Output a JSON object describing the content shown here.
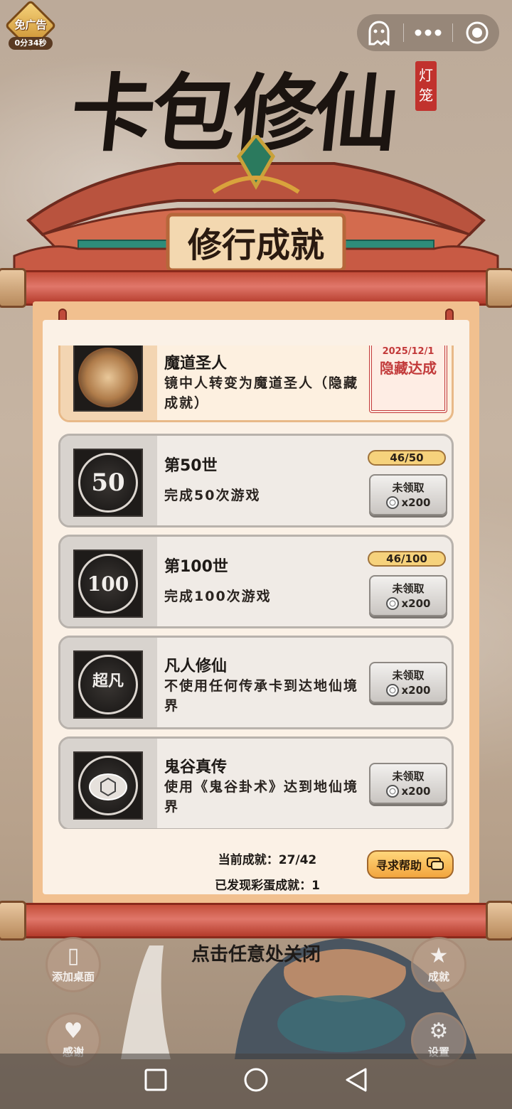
{
  "ad_badge": {
    "label": "免广告",
    "timer": "0分34秒"
  },
  "capsule": {
    "icons": [
      "ghost-icon",
      "more-icon",
      "record-icon"
    ]
  },
  "game": {
    "title": "卡包修仙",
    "seal": "灯笼"
  },
  "panel": {
    "title": "修行成就"
  },
  "achievements": [
    {
      "title": "魔道圣人",
      "desc": "镜中人转变为魔道圣人（隐藏成就）",
      "icon": "skull-emblem-icon",
      "status": "achieved",
      "stamp_date": "2025/12/1",
      "stamp_text": "隐藏达成"
    },
    {
      "title": "第50世",
      "desc": "完成50次游戏",
      "icon_text": "50",
      "progress": "46/50",
      "claim_label": "未领取",
      "reward": "x200"
    },
    {
      "title": "第100世",
      "desc": "完成100次游戏",
      "icon_text": "100",
      "progress": "46/100",
      "claim_label": "未领取",
      "reward": "x200"
    },
    {
      "title": "凡人修仙",
      "desc": "不使用任何传承卡到达地仙境界",
      "icon": "immortal-figure-icon",
      "icon_text": "超凡",
      "claim_label": "未领取",
      "reward": "x200"
    },
    {
      "title": "鬼谷真传",
      "desc": "使用《鬼谷卦术》达到地仙境界",
      "icon": "turtle-shell-icon",
      "claim_label": "未领取",
      "reward": "x200"
    }
  ],
  "stats": {
    "current": "当前成就：27/42",
    "easter": "已发现彩蛋成就：1"
  },
  "help_button": "寻求帮助",
  "close_hint": "点击任意处关闭",
  "side_buttons": {
    "add_desktop": "添加桌面",
    "thanks": "感谢",
    "achievements": "成就",
    "settings": "设置"
  },
  "navbar": {
    "icons": [
      "square-icon",
      "circle-home-icon",
      "triangle-back-icon"
    ]
  },
  "colors": {
    "accent_red": "#c23a3a",
    "gold": "#f6d27c",
    "paper": "#fbf1e6"
  }
}
